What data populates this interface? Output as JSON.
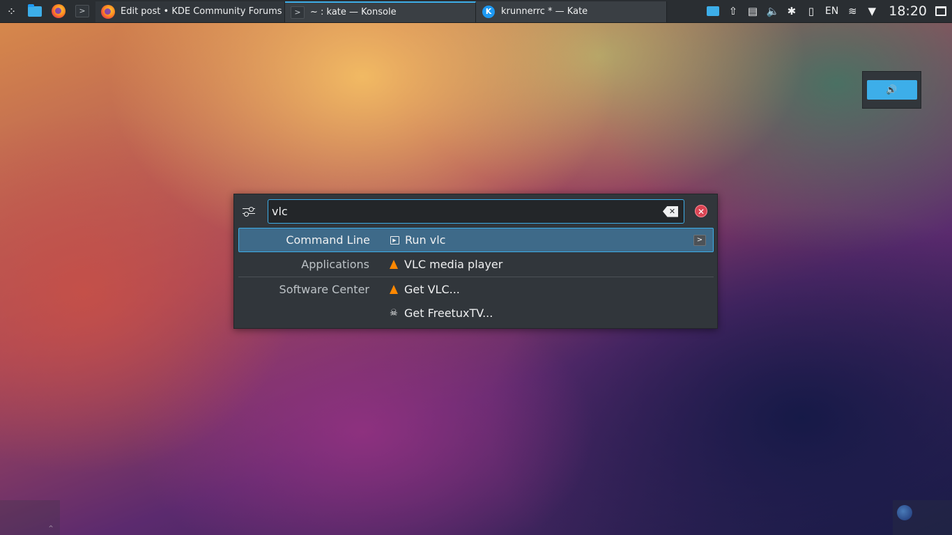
{
  "panel": {
    "launcher_icon": "application-launcher-icon",
    "quick_launch": [
      {
        "name": "file-manager",
        "icon": "folder-icon"
      },
      {
        "name": "firefox",
        "icon": "firefox-icon"
      },
      {
        "name": "konsole",
        "icon": "terminal-icon"
      }
    ],
    "tasks": [
      {
        "title": "Edit post • KDE Community Forums — ...",
        "icon": "firefox-icon",
        "active": false
      },
      {
        "title": "~ : kate — Konsole",
        "icon": "terminal-icon",
        "active": true
      },
      {
        "title": "krunnerrc * — Kate",
        "icon": "kate-icon",
        "active": false
      }
    ],
    "tray": {
      "language": "EN",
      "clock": "18:20"
    }
  },
  "osd": {
    "icon": "volume-icon"
  },
  "krunner": {
    "query": "vlc",
    "results": [
      {
        "category": "Command Line",
        "label": "Run vlc",
        "icon": "run-command-icon",
        "selected": true
      },
      {
        "category": "Applications",
        "label": "VLC media player",
        "icon": "vlc-icon",
        "selected": false
      },
      {
        "category": "Software Center",
        "label": "Get VLC...",
        "icon": "vlc-icon",
        "selected": false
      },
      {
        "category": "",
        "label": "Get FreetuxTV...",
        "icon": "freetuxtv-icon",
        "selected": false
      }
    ]
  },
  "colors": {
    "accent": "#3daee9",
    "selection": "#3e6a89",
    "panel_bg": "#2a2e32",
    "close": "#da4453"
  }
}
